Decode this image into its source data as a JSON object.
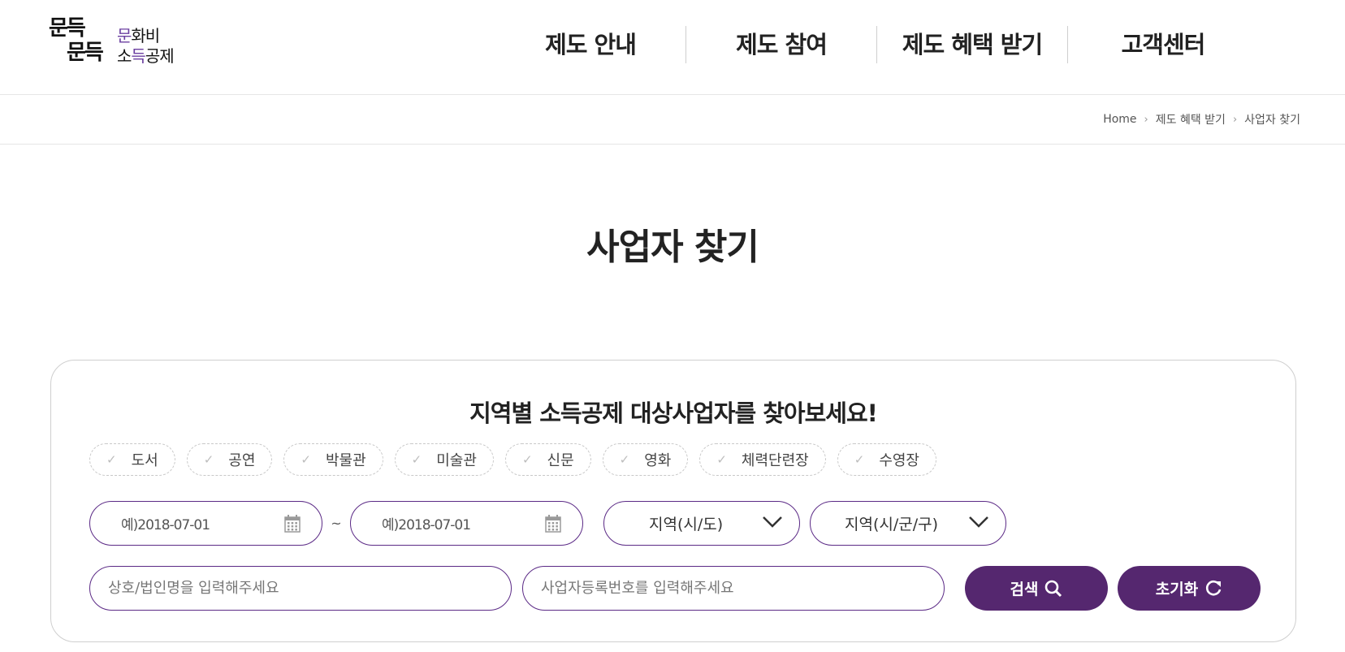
{
  "logo": {
    "script_line1": "문득",
    "script_line2": "문득",
    "sub_line1_accent": "문",
    "sub_line1_rest": "화비",
    "sub_line2_pre": "소",
    "sub_line2_accent": "득",
    "sub_line2_rest": "공제"
  },
  "nav": {
    "items": [
      {
        "label": "제도 안내"
      },
      {
        "label": "제도 참여"
      },
      {
        "label": "제도 혜택 받기"
      },
      {
        "label": "고객센터"
      }
    ]
  },
  "breadcrumb": {
    "items": [
      "Home",
      "제도 혜택 받기",
      "사업자 찾기"
    ]
  },
  "page": {
    "title": "사업자 찾기"
  },
  "search": {
    "heading": "지역별 소득공제 대상사업자를 찾아보세요!",
    "categories": [
      "도서",
      "공연",
      "박물관",
      "미술관",
      "신문",
      "영화",
      "체력단련장",
      "수영장"
    ],
    "date_from_placeholder": "예)2018-07-01",
    "date_separator": "~",
    "date_to_placeholder": "예)2018-07-01",
    "region_sido": "지역(시/도)",
    "region_sigungu": "지역(시/군/구)",
    "name_placeholder": "상호/법인명을 입력해주세요",
    "bizno_placeholder": "사업자등록번호를 입력해주세요",
    "search_label": "검색",
    "reset_label": "초기화"
  },
  "colors": {
    "accent": "#55276f",
    "border_accent": "#5b2a86",
    "logo_accent": "#6b3fa0"
  }
}
